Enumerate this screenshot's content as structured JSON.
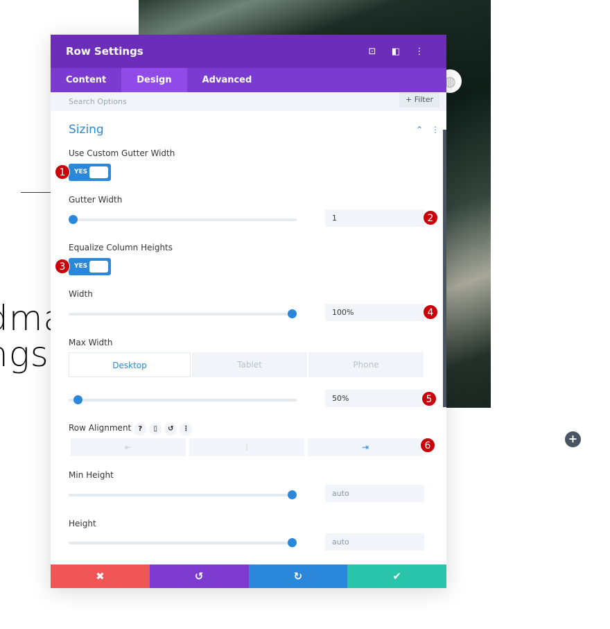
{
  "background": {
    "text_line1": "dma",
    "text_line2": "ngs"
  },
  "modal": {
    "title": "Row Settings",
    "tabs": [
      {
        "label": "Content"
      },
      {
        "label": "Design",
        "active": true
      },
      {
        "label": "Advanced"
      }
    ],
    "search_placeholder": "Search Options",
    "filter_label": "Filter",
    "section_title": "Sizing",
    "fields": {
      "custom_gutter": {
        "label": "Use Custom Gutter Width",
        "toggle": "YES"
      },
      "gutter_width": {
        "label": "Gutter Width",
        "value": "1",
        "slider": 1
      },
      "equalize": {
        "label": "Equalize Column Heights",
        "toggle": "YES"
      },
      "width": {
        "label": "Width",
        "value": "100%",
        "slider": 100
      },
      "max_width": {
        "label": "Max Width",
        "value": "50%",
        "devices": [
          "Desktop",
          "Tablet",
          "Phone"
        ],
        "active_device": "Desktop"
      },
      "row_alignment": {
        "label": "Row Alignment",
        "selected": "right"
      },
      "min_height": {
        "label": "Min Height",
        "placeholder": "auto"
      },
      "height": {
        "label": "Height",
        "placeholder": "auto"
      }
    },
    "badges": [
      "1",
      "2",
      "3",
      "4",
      "5",
      "6"
    ],
    "footer": {
      "colors": {
        "cancel": "#ef5555",
        "undo": "#7e3bd0",
        "redo": "#2b87da",
        "save": "#29c4a9"
      }
    }
  },
  "colors": {
    "header": "#6c2eb9",
    "tabs": "#7b3bd1",
    "accent": "#2b87da",
    "badge": "#c8000a"
  }
}
